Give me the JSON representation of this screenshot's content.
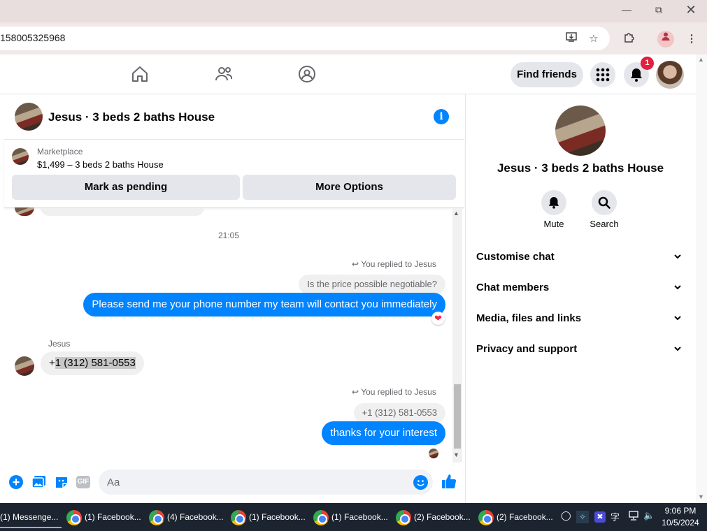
{
  "browser": {
    "url": "158005325968"
  },
  "fb_nav": {
    "find_friends": "Find friends",
    "notification_count": "1"
  },
  "chat_header": {
    "title": "Jesus · 3 beds 2 baths House"
  },
  "marketplace": {
    "label": "Marketplace",
    "listing": "$1,499 – 3 beds 2 baths House",
    "mark_pending": "Mark as pending",
    "more_options": "More Options"
  },
  "messages": {
    "timestamp": "21:05",
    "reply1_label": "You replied to Jesus",
    "reply1_quote": "Is the price possible negotiable?",
    "msg1": "Please send me your phone number my team will contact you immediately",
    "sender_name": "Jesus",
    "incoming_prefix": "+",
    "incoming_selected": "1 (312) 581-0553",
    "reply2_label": "You replied to Jesus",
    "reply2_quote": "+1 (312) 581-0553",
    "msg2": "thanks for your interest"
  },
  "composer": {
    "placeholder": "Aa",
    "gif_label": "GIF"
  },
  "right_panel": {
    "title": "Jesus · 3 beds 2 baths House",
    "mute_label": "Mute",
    "search_label": "Search",
    "sections": [
      "Customise chat",
      "Chat members",
      "Media, files and links",
      "Privacy and support"
    ]
  },
  "taskbar": {
    "tasks": [
      "(1) Messenge...",
      "(1) Facebook...",
      "(4) Facebook...",
      "(1) Facebook...",
      "(1) Facebook...",
      "(2) Facebook...",
      "(2) Facebook..."
    ],
    "time": "9:06 PM",
    "date": "10/5/2024"
  },
  "colors": {
    "messenger_blue": "#0084ff",
    "notification_red": "#e41e3f",
    "reaction_red": "#f02849"
  }
}
